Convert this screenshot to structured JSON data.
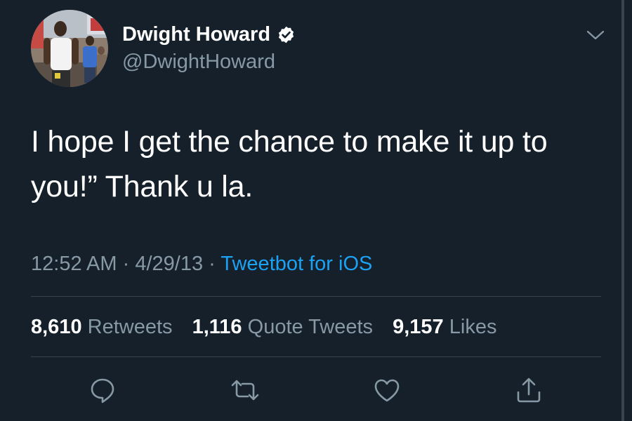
{
  "author": {
    "display_name": "Dwight Howard",
    "handle": "@DwightHoward",
    "verified": true
  },
  "tweet": {
    "text": "I hope I get the chance to make it up to you!” Thank u la.",
    "time": "12:52 AM",
    "separator": "·",
    "date": "4/29/13",
    "source": "Tweetbot for iOS"
  },
  "stats": {
    "retweets_count": "8,610",
    "retweets_label": "Retweets",
    "quotes_count": "1,116",
    "quotes_label": "Quote Tweets",
    "likes_count": "9,157",
    "likes_label": "Likes"
  },
  "icons": {
    "menu": "chevron-down-icon",
    "verified": "verified-badge-icon",
    "reply": "reply-icon",
    "retweet": "retweet-icon",
    "like": "heart-icon",
    "share": "share-icon"
  },
  "colors": {
    "background": "#15202b",
    "text": "#ffffff",
    "secondary": "#8899a6",
    "accent": "#1da1f2",
    "divider": "#38444d"
  }
}
